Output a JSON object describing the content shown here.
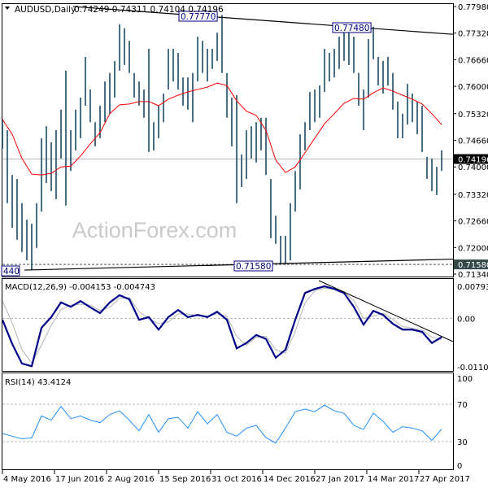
{
  "header": {
    "arrow_icon": "triangle-down-icon",
    "symbol": "AUDUSD,Daily",
    "ohlc": "0.74249 0.74311 0.74104 0.74196"
  },
  "watermark": "ActionForex.com",
  "colors": {
    "bars": "#1b4a63",
    "ma": "#ff0000",
    "macd": "#00008b",
    "signal": "#b4b4b4",
    "rsi": "#1e90ff",
    "current_price_bg": "#000000",
    "level_bg": "#354848"
  },
  "chart_data": [
    {
      "type": "ohlc-bar",
      "symbol": "AUDUSD",
      "timeframe": "Daily",
      "ylim": [
        0.7134,
        0.7798
      ],
      "y_ticks": [
        "0.77980",
        "0.77320",
        "0.76660",
        "0.76000",
        "0.75320",
        "0.74660",
        "0.74000",
        "0.73320",
        "0.72660",
        "0.72000",
        "0.71340"
      ],
      "x_ticks": [
        "4 May 2016",
        "17 Jun 2016",
        "2 Aug 2016",
        "15 Sep 2016",
        "31 Oct 2016",
        "14 Dec 2016",
        "27 Jan 2017",
        "14 Mar 2017",
        "27 Apr 2017"
      ],
      "current_price": "0.74196",
      "level_label": "0.71580",
      "annotations": [
        "0.77770",
        "0.77480",
        "0.71580",
        "440"
      ],
      "bars_high_low": [
        [
          0.7518,
          0.7445
        ],
        [
          0.7491,
          0.731
        ],
        [
          0.738,
          0.7249
        ],
        [
          0.737,
          0.7219
        ],
        [
          0.731,
          0.7189
        ],
        [
          0.7269,
          0.7168
        ],
        [
          0.7259,
          0.7144
        ],
        [
          0.731,
          0.7199
        ],
        [
          0.7471,
          0.7289
        ],
        [
          0.7501,
          0.736
        ],
        [
          0.7461,
          0.734
        ],
        [
          0.7491,
          0.732
        ],
        [
          0.7542,
          0.7421
        ],
        [
          0.7639,
          0.7304
        ],
        [
          0.7491,
          0.739
        ],
        [
          0.7542,
          0.7441
        ],
        [
          0.7572,
          0.7471
        ],
        [
          0.7673,
          0.7552
        ],
        [
          0.7592,
          0.7511
        ],
        [
          0.7511,
          0.7451
        ],
        [
          0.7552,
          0.7471
        ],
        [
          0.7612,
          0.7511
        ],
        [
          0.7633,
          0.7532
        ],
        [
          0.7663,
          0.7572
        ],
        [
          0.7754,
          0.7639
        ],
        [
          0.7744,
          0.7653
        ],
        [
          0.7713,
          0.7633
        ],
        [
          0.7633,
          0.7572
        ],
        [
          0.7612,
          0.7552
        ],
        [
          0.7592,
          0.7522
        ],
        [
          0.7693,
          0.7437
        ],
        [
          0.7511,
          0.7441
        ],
        [
          0.7552,
          0.7471
        ],
        [
          0.7582,
          0.7511
        ],
        [
          0.7693,
          0.7592
        ],
        [
          0.7693,
          0.7612
        ],
        [
          0.7683,
          0.7592
        ],
        [
          0.7622,
          0.7552
        ],
        [
          0.7622,
          0.7542
        ],
        [
          0.7633,
          0.7511
        ],
        [
          0.7723,
          0.7612
        ],
        [
          0.7713,
          0.7633
        ],
        [
          0.7693,
          0.7612
        ],
        [
          0.7693,
          0.7643
        ],
        [
          0.7733,
          0.7663
        ],
        [
          0.7777,
          0.7633
        ],
        [
          0.7633,
          0.7522
        ],
        [
          0.7572,
          0.7451
        ],
        [
          0.7578,
          0.731
        ],
        [
          0.7431,
          0.735
        ],
        [
          0.7491,
          0.737
        ],
        [
          0.7501,
          0.7421
        ],
        [
          0.7511,
          0.7411
        ],
        [
          0.7522,
          0.7441
        ],
        [
          0.7522,
          0.738
        ],
        [
          0.737,
          0.7223
        ],
        [
          0.7279,
          0.7209
        ],
        [
          0.7229,
          0.7158
        ],
        [
          0.7229,
          0.7158
        ],
        [
          0.731,
          0.7168
        ],
        [
          0.739,
          0.7289
        ],
        [
          0.7481,
          0.7344
        ],
        [
          0.7511,
          0.7441
        ],
        [
          0.7586,
          0.7491
        ],
        [
          0.7592,
          0.7511
        ],
        [
          0.7602,
          0.7522
        ],
        [
          0.7693,
          0.7586
        ],
        [
          0.7683,
          0.7612
        ],
        [
          0.7693,
          0.7622
        ],
        [
          0.7723,
          0.7643
        ],
        [
          0.7744,
          0.7663
        ],
        [
          0.7748,
          0.7653
        ],
        [
          0.7723,
          0.7633
        ],
        [
          0.7633,
          0.7552
        ],
        [
          0.7592,
          0.7491
        ],
        [
          0.7717,
          0.7572
        ],
        [
          0.7748,
          0.7667
        ],
        [
          0.7673,
          0.7602
        ],
        [
          0.7663,
          0.7582
        ],
        [
          0.7673,
          0.7602
        ],
        [
          0.7633,
          0.7542
        ],
        [
          0.7562,
          0.7471
        ],
        [
          0.7532,
          0.7471
        ],
        [
          0.7606,
          0.7505
        ],
        [
          0.7582,
          0.7511
        ],
        [
          0.7562,
          0.7481
        ],
        [
          0.7552,
          0.7437
        ],
        [
          0.7425,
          0.737
        ],
        [
          0.7421,
          0.734
        ],
        [
          0.74,
          0.733
        ],
        [
          0.7441,
          0.739
        ]
      ],
      "moving_average": [
        0.7518,
        0.7481,
        0.7421,
        0.7382,
        0.738,
        0.7384,
        0.74,
        0.7402,
        0.7427,
        0.7457,
        0.7485,
        0.7532,
        0.7554,
        0.7556,
        0.7562,
        0.7562,
        0.7552,
        0.7568,
        0.7578,
        0.7586,
        0.7592,
        0.7598,
        0.7608,
        0.7602,
        0.7564,
        0.7538,
        0.7528,
        0.7491,
        0.7417,
        0.7386,
        0.74,
        0.7435,
        0.7471,
        0.7507,
        0.7532,
        0.7558,
        0.757,
        0.7568,
        0.7584,
        0.7596,
        0.7588,
        0.7578,
        0.7568,
        0.7556,
        0.7532,
        0.7505
      ],
      "trendlines": [
        {
          "from": 0.7806,
          "to": 0.7729
        },
        {
          "from": 0.7144,
          "to": 0.7171
        }
      ]
    },
    {
      "type": "line",
      "title": "MACD(12,26,9) -0.004153 -0.004743",
      "ylim": [
        -0.011017,
        0.007933
      ],
      "y_ticks": [
        "0.007933",
        "0.00",
        "-0.011017"
      ],
      "series": [
        {
          "values": [
            -0.0003,
            -0.0057,
            -0.0101,
            -0.0107,
            -0.0021,
            0.0003,
            0.0036,
            0.0026,
            0.0039,
            0.0025,
            0.0012,
            0.0036,
            0.0052,
            0.0043,
            -0.0003,
            0.0003,
            -0.0025,
            0.0003,
            0.0019,
            0.0003,
            0.0008,
            0.0003,
            0.0015,
            -0.0003,
            -0.0067,
            -0.0055,
            -0.0037,
            -0.0046,
            -0.0088,
            -0.007,
            -0.0003,
            0.0057,
            0.0066,
            0.0072,
            0.0066,
            0.0057,
            0.0026,
            -0.0014,
            0.0017,
            0.0008,
            -0.0012,
            -0.0025,
            -0.0025,
            -0.003,
            -0.0055,
            -0.0042
          ]
        },
        {
          "values": [
            0.0039,
            -0.001,
            -0.007,
            -0.01,
            -0.006,
            -0.0015,
            0.002,
            0.003,
            0.0032,
            0.003,
            0.0018,
            0.0025,
            0.0045,
            0.0047,
            0.0015,
            0.0,
            -0.0012,
            -0.0008,
            0.001,
            0.001,
            0.0006,
            0.0005,
            0.001,
            0.0005,
            -0.004,
            -0.006,
            -0.0042,
            -0.004,
            -0.007,
            -0.0078,
            -0.003,
            0.0035,
            0.0062,
            0.0068,
            0.0066,
            0.006,
            0.004,
            0.0,
            0.0005,
            0.0012,
            -0.0002,
            -0.0018,
            -0.0022,
            -0.0026,
            -0.0042,
            -0.0047
          ]
        }
      ]
    },
    {
      "type": "line",
      "title": "RSI(14) 43.4124",
      "ylim": [
        0,
        100
      ],
      "y_ticks": [
        "100",
        "70",
        "30",
        "0"
      ],
      "series": [
        {
          "values": [
            38.7,
            35.8,
            33,
            34,
            57.5,
            53,
            67.7,
            54.6,
            57.5,
            53,
            50.3,
            59,
            63,
            53,
            41.6,
            59,
            40,
            54.6,
            56,
            44.5,
            62,
            49,
            59,
            40,
            35.8,
            44.5,
            47.4,
            34.3,
            28.5,
            44.5,
            62,
            64.8,
            62,
            69,
            63,
            60.4,
            47.4,
            43,
            60.4,
            51.7,
            40,
            46,
            44.5,
            41.6,
            31.4,
            43.4
          ]
        }
      ]
    }
  ]
}
